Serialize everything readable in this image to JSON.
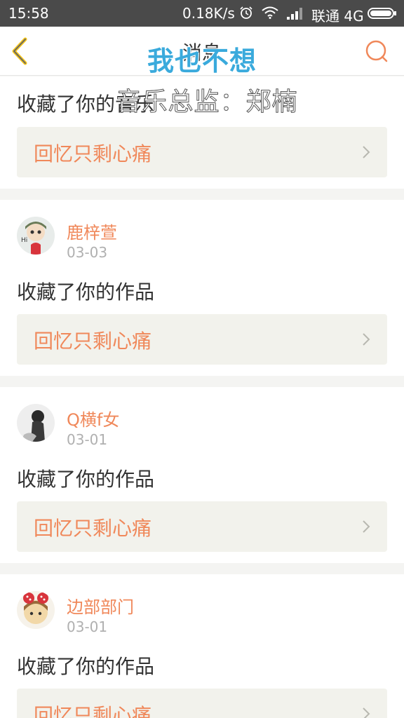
{
  "status_bar": {
    "time": "15:58",
    "speed": "0.18K/s",
    "carrier": "联通 4G",
    "icons": [
      "alarm-icon",
      "wifi-icon",
      "signal-icon",
      "battery-icon"
    ]
  },
  "nav": {
    "title": "消息",
    "back_icon": "chevron-left-icon",
    "search_icon": "search-icon"
  },
  "overlay": {
    "line1": "我也不想",
    "line2": "音乐总监：郑楠"
  },
  "colors": {
    "accent": "#f0885a",
    "overlay_blue": "#3aaadc",
    "work_bg": "#f2f2ec",
    "status_bg": "#4a4a4a"
  },
  "messages": [
    {
      "action": "收藏了你的音乐",
      "work_title": "回忆只剩心痛"
    },
    {
      "name": "鹿梓萱",
      "date": "03-03",
      "action": "收藏了你的作品",
      "work_title": "回忆只剩心痛"
    },
    {
      "name": "Q横f女",
      "date": "03-01",
      "action": "收藏了你的作品",
      "work_title": "回忆只剩心痛"
    },
    {
      "name": "边部部门",
      "date": "03-01",
      "action": "收藏了你的作品",
      "work_title": "回忆只剩心痛"
    }
  ]
}
